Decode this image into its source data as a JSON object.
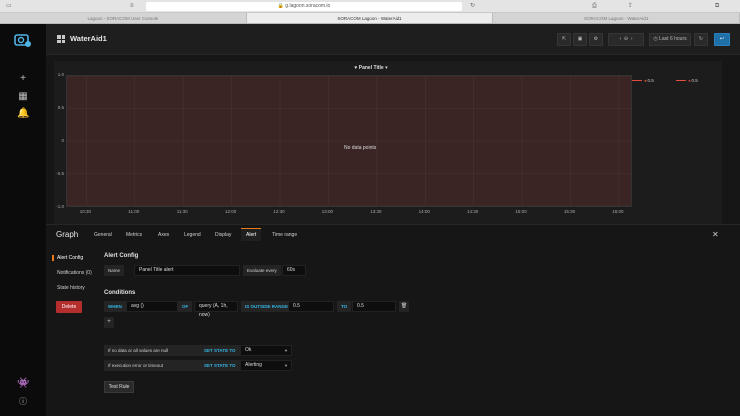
{
  "browser": {
    "url": "g.lagoon.soracom.io",
    "tabs": [
      "Lagoon - SORACOM User Console",
      "SORACOM Lagoon - WaterAid1",
      "SORACOM Lagoon - WaterAid1"
    ]
  },
  "dashboard": {
    "title": "WaterAid1",
    "time_range_label": "Last 6 hours"
  },
  "panel": {
    "title": "Panel Title",
    "no_data": "No data points",
    "thresholds": [
      "0.5",
      "0.5"
    ]
  },
  "chart_data": {
    "type": "line",
    "x": [
      "10:30",
      "11:00",
      "11:30",
      "12:00",
      "12:30",
      "13:00",
      "13:30",
      "14:00",
      "14:30",
      "15:00",
      "15:30",
      "16:00"
    ],
    "y_ticks": [
      "1.0",
      "0.5",
      "0",
      "-0.5",
      "-1.0"
    ],
    "ylim": [
      -1.0,
      1.0
    ],
    "series": [],
    "grid": true,
    "legend": "right"
  },
  "editor": {
    "title": "Graph",
    "tabs": [
      "General",
      "Metrics",
      "Axes",
      "Legend",
      "Display",
      "Alert",
      "Time range"
    ],
    "active_tab": "Alert",
    "side_items": [
      "Alert Config",
      "Notifications (0)",
      "State history"
    ],
    "delete_label": "Delete",
    "alert_config": {
      "heading": "Alert Config",
      "name_label": "Name",
      "name_value": "Panel Title alert",
      "evaluate_label": "Evaluate every",
      "evaluate_value": "60s"
    },
    "conditions": {
      "heading": "Conditions",
      "when_label": "WHEN",
      "reducer": "avg ()",
      "of_label": "OF",
      "query": "query (A, 1h, now)",
      "evaluator": "IS OUTSIDE RANGE",
      "from_value": "0.5",
      "to_label": "TO",
      "to_value": "0.5",
      "add_label": "+",
      "remove_label": "🗑"
    },
    "no_data": {
      "label": "If no data or all values are null",
      "set_state_label": "SET STATE TO",
      "value": "Ok"
    },
    "exec_error": {
      "label": "If execution error or timeout",
      "set_state_label": "SET STATE TO",
      "value": "Alerting"
    },
    "test_rule_label": "Test Rule"
  },
  "colors": {
    "threshold_fill": "#3a2424",
    "threshold_line": "#e24d42",
    "accent": "#eb7b18",
    "keyword": "#33b5e5",
    "delete": "#b52d2d"
  }
}
